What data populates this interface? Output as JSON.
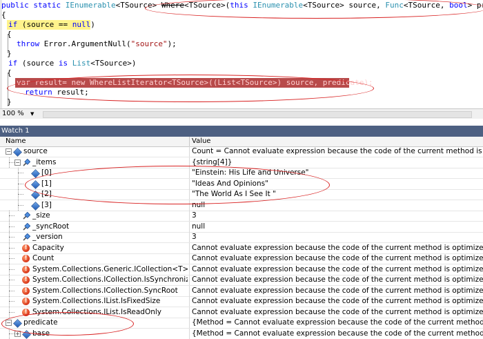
{
  "editor": {
    "lines": [
      {
        "tokens": [
          {
            "t": "public",
            "c": "kw"
          },
          {
            "t": " "
          },
          {
            "t": "static",
            "c": "kw"
          },
          {
            "t": " "
          },
          {
            "t": "IEnumerable",
            "c": "ty"
          },
          {
            "t": "<TSource> "
          },
          {
            "t": "Where",
            "c": "struck"
          },
          {
            "t": "<TSource>("
          },
          {
            "t": "this",
            "c": "kw"
          },
          {
            "t": " "
          },
          {
            "t": "IEnumerable",
            "c": "ty"
          },
          {
            "t": "<TSource> source, "
          },
          {
            "t": "Func",
            "c": "ty"
          },
          {
            "t": "<TSource, "
          },
          {
            "t": "bool",
            "c": "kw"
          },
          {
            "t": "> predicate)"
          }
        ]
      },
      {
        "tokens": [
          {
            "t": "{"
          }
        ]
      },
      {
        "tokens": [
          {
            "t": "if",
            "c": "kw"
          },
          {
            "t": " (source == "
          },
          {
            "t": "null",
            "c": "kw"
          },
          {
            "t": ")"
          }
        ]
      },
      {
        "tokens": [
          {
            "t": "{"
          }
        ]
      },
      {
        "tokens": [
          {
            "t": "throw",
            "c": "kw"
          },
          {
            "t": " Error.ArgumentNull("
          },
          {
            "t": "\"source\"",
            "c": "str"
          },
          {
            "t": ");"
          }
        ]
      },
      {
        "tokens": [
          {
            "t": "}"
          }
        ]
      },
      {
        "tokens": [
          {
            "t": "if",
            "c": "kw"
          },
          {
            "t": " (source "
          },
          {
            "t": "is",
            "c": "kw"
          },
          {
            "t": " "
          },
          {
            "t": "List",
            "c": "ty"
          },
          {
            "t": "<TSource>)"
          }
        ]
      },
      {
        "tokens": [
          {
            "t": "{"
          }
        ]
      },
      {
        "tokens": [
          {
            "t": "var result= new WhereListIterator<TSource>((List<TSource>) source, predicate);"
          }
        ]
      },
      {
        "tokens": [
          {
            "t": "return",
            "c": "kw"
          },
          {
            "t": " result;"
          }
        ]
      },
      {
        "tokens": [
          {
            "t": "}"
          }
        ]
      }
    ],
    "zoom": "100 %"
  },
  "watch": {
    "title": "Watch 1",
    "col_name": "Name",
    "col_value": "Value",
    "rows": [
      {
        "name": "source",
        "value": "Count = Cannot evaluate expression because the code of the current method is optimized.",
        "icon": "field-icon",
        "expander": "−"
      },
      {
        "name": "_items",
        "value": "{string[4]}",
        "icon": "property-icon",
        "expander": "−"
      },
      {
        "name": "[0]",
        "value": "\"Einstein: His Life and Universe\"",
        "icon": "field-icon",
        "expander": ""
      },
      {
        "name": "[1]",
        "value": "\"Ideas And Opinions\"",
        "icon": "field-icon",
        "expander": ""
      },
      {
        "name": "[2]",
        "value": "\"The World As I See It \"",
        "icon": "field-icon",
        "expander": ""
      },
      {
        "name": "[3]",
        "value": "null",
        "icon": "field-icon",
        "expander": ""
      },
      {
        "name": "_size",
        "value": "3",
        "icon": "property-icon",
        "expander": ""
      },
      {
        "name": "_syncRoot",
        "value": "null",
        "icon": "property-icon",
        "expander": ""
      },
      {
        "name": "_version",
        "value": "3",
        "icon": "property-icon",
        "expander": ""
      },
      {
        "name": "Capacity",
        "value": "Cannot evaluate expression because the code of the current method is optimized.",
        "icon": "error-icon",
        "expander": ""
      },
      {
        "name": "Count",
        "value": "Cannot evaluate expression because the code of the current method is optimized.",
        "icon": "error-icon",
        "expander": ""
      },
      {
        "name": "System.Collections.Generic.ICollection<T>.IsRe",
        "value": "Cannot evaluate expression because the code of the current method is optimized.",
        "icon": "error-icon",
        "expander": ""
      },
      {
        "name": "System.Collections.ICollection.IsSynchronized",
        "value": "Cannot evaluate expression because the code of the current method is optimized.",
        "icon": "error-icon",
        "expander": ""
      },
      {
        "name": "System.Collections.ICollection.SyncRoot",
        "value": "Cannot evaluate expression because the code of the current method is optimized.",
        "icon": "error-icon",
        "expander": ""
      },
      {
        "name": "System.Collections.IList.IsFixedSize",
        "value": "Cannot evaluate expression because the code of the current method is optimized.",
        "icon": "error-icon",
        "expander": ""
      },
      {
        "name": "System.Collections.IList.IsReadOnly",
        "value": "Cannot evaluate expression because the code of the current method is optimized.",
        "icon": "error-icon",
        "expander": ""
      },
      {
        "name": "predicate",
        "value": "{Method = Cannot evaluate expression because the code of the current method is optimize",
        "icon": "field-icon",
        "expander": "−"
      },
      {
        "name": "base",
        "value": "{Method = Cannot evaluate expression because the code of the current method is optimize",
        "icon": "field-icon",
        "expander": "+"
      }
    ]
  },
  "colors": {
    "keyword": "#0000ff",
    "type": "#2b91af",
    "string": "#a31515",
    "current_line": "#fff38c",
    "breakpoint_line": "#b84a4a",
    "watch_title_bg": "#4d6082",
    "annotation": "#d82020"
  }
}
